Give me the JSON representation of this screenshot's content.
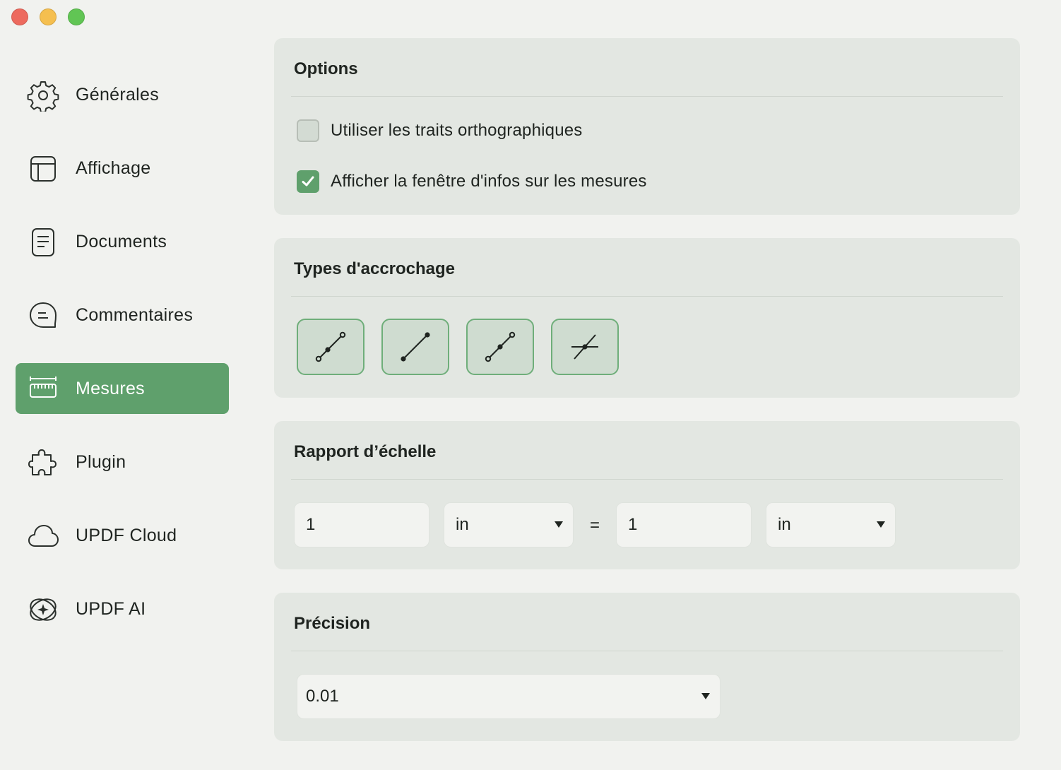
{
  "window": {
    "traffic_lights": [
      "close",
      "minimize",
      "zoom"
    ]
  },
  "sidebar": {
    "items": [
      {
        "label": "Générales",
        "icon": "gear-icon",
        "active": false
      },
      {
        "label": "Affichage",
        "icon": "layout-icon",
        "active": false
      },
      {
        "label": "Documents",
        "icon": "document-icon",
        "active": false
      },
      {
        "label": "Commentaires",
        "icon": "comment-icon",
        "active": false
      },
      {
        "label": "Mesures",
        "icon": "ruler-icon",
        "active": true
      },
      {
        "label": "Plugin",
        "icon": "puzzle-icon",
        "active": false
      },
      {
        "label": "UPDF Cloud",
        "icon": "cloud-icon",
        "active": false
      },
      {
        "label": "UPDF AI",
        "icon": "ai-sparkle-icon",
        "active": false
      }
    ]
  },
  "options": {
    "title": "Options",
    "items": [
      {
        "label": "Utiliser les traits orthographiques",
        "checked": false
      },
      {
        "label": "Afficher la fenêtre d'infos sur les mesures",
        "checked": true
      }
    ]
  },
  "snap": {
    "title": "Types d'accrochage",
    "buttons": [
      "snap-to-paths-icon",
      "snap-to-endpoints-icon",
      "snap-to-midpoints-icon",
      "snap-to-intersections-icon"
    ]
  },
  "scale": {
    "title": "Rapport d’échelle",
    "left_value": "1",
    "left_unit": "in",
    "equals": "=",
    "right_value": "1",
    "right_unit": "in"
  },
  "precision": {
    "title": "Précision",
    "value": "0.01"
  },
  "colors": {
    "accent": "#5fa06c",
    "panel": "#e3e7e2",
    "background": "#f1f2ef"
  }
}
